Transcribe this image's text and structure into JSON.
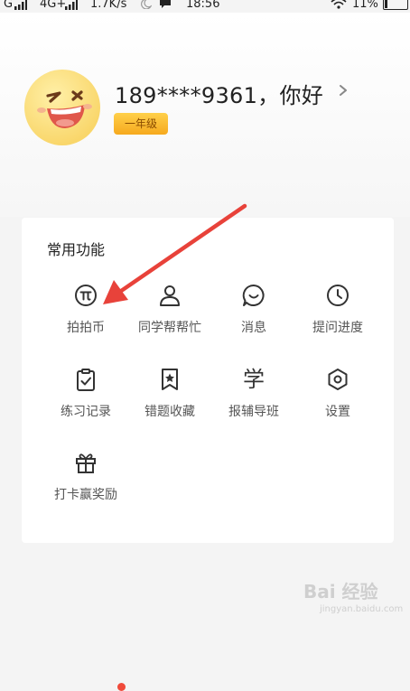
{
  "status_bar": {
    "network": "G",
    "network2": "4G+",
    "speed": "1.7K/s",
    "time": "18:56",
    "battery": "11%",
    "battery_level": 0.11
  },
  "profile": {
    "username": "189****9361，你好",
    "grade": "一年级",
    "avatar_icon": "emoji-face-icon"
  },
  "functions": {
    "title": "常用功能",
    "items": [
      {
        "label": "拍拍币",
        "icon": "pi-coin-icon"
      },
      {
        "label": "同学帮帮忙",
        "icon": "person-icon"
      },
      {
        "label": "消息",
        "icon": "message-icon"
      },
      {
        "label": "提问进度",
        "icon": "clock-icon"
      },
      {
        "label": "练习记录",
        "icon": "clipboard-check-icon"
      },
      {
        "label": "错题收藏",
        "icon": "bookmark-star-icon"
      },
      {
        "label": "报辅导班",
        "icon": "study-char-icon",
        "glyph": "学"
      },
      {
        "label": "设置",
        "icon": "hexagon-gear-icon"
      },
      {
        "label": "打卡赢奖励",
        "icon": "gift-icon",
        "badge": true
      }
    ]
  },
  "annotation": {
    "arrow_color": "#e8423a"
  },
  "watermark": {
    "main": "Bai 经验",
    "sub": "jingyan.baidu.com"
  },
  "colors": {
    "accent": "#f6a91e",
    "badge_dot": "#f04a3a",
    "card_bg": "#ffffff",
    "page_bg": "#f4f4f4"
  }
}
